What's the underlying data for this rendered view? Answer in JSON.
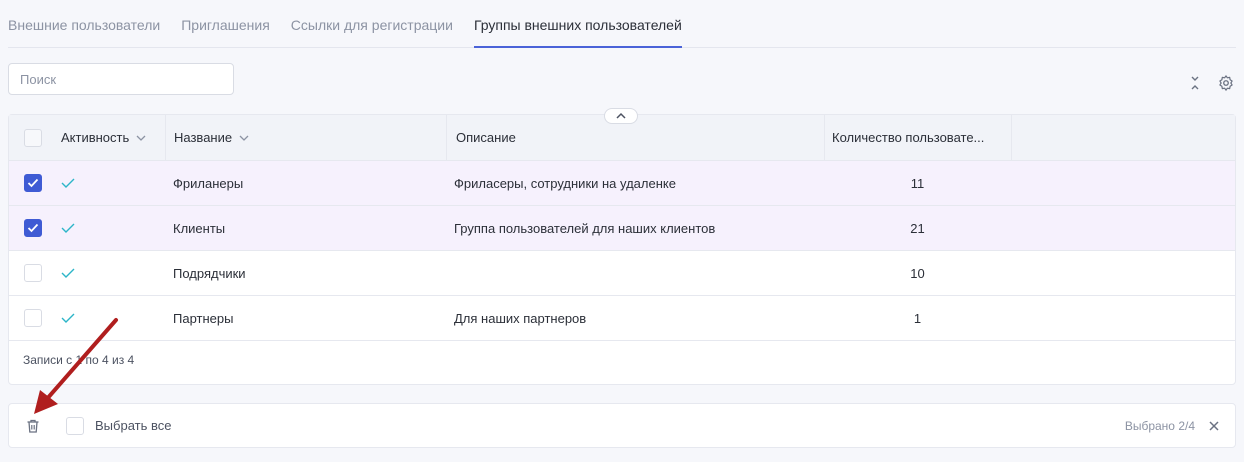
{
  "tabs": [
    {
      "label": "Внешние пользователи",
      "active": false
    },
    {
      "label": "Приглашения",
      "active": false
    },
    {
      "label": "Ссылки для регистрации",
      "active": false
    },
    {
      "label": "Группы внешних пользователей",
      "active": true
    }
  ],
  "search": {
    "placeholder": "Поиск",
    "value": ""
  },
  "toolbar": {
    "icons": [
      "collapse-icon",
      "settings-icon"
    ]
  },
  "table": {
    "columns": {
      "activity": "Активность",
      "name": "Название",
      "description": "Описание",
      "user_count": "Количество пользовате..."
    },
    "rows": [
      {
        "selected": true,
        "active": true,
        "name": "Фриланеры",
        "description": "Фриласеры, сотрудники на удаленке",
        "count": "11"
      },
      {
        "selected": true,
        "active": true,
        "name": "Клиенты",
        "description": "Группа пользователей для наших клиентов",
        "count": "21"
      },
      {
        "selected": false,
        "active": true,
        "name": "Подрядчики",
        "description": "",
        "count": "10"
      },
      {
        "selected": false,
        "active": true,
        "name": "Партнеры",
        "description": "Для наших партнеров",
        "count": "1"
      }
    ],
    "footer": "Записи с 1 по 4 из 4"
  },
  "bulk_bar": {
    "select_all_label": "Выбрать все",
    "selected_label": "Выбрано 2/4",
    "icons": [
      "trash-icon",
      "close-icon"
    ]
  },
  "colors": {
    "accent": "#3f5bd4",
    "selected_row": "#f6f1fd",
    "check_active": "#2cb5c8",
    "annotation_arrow": "#b01e1e"
  }
}
